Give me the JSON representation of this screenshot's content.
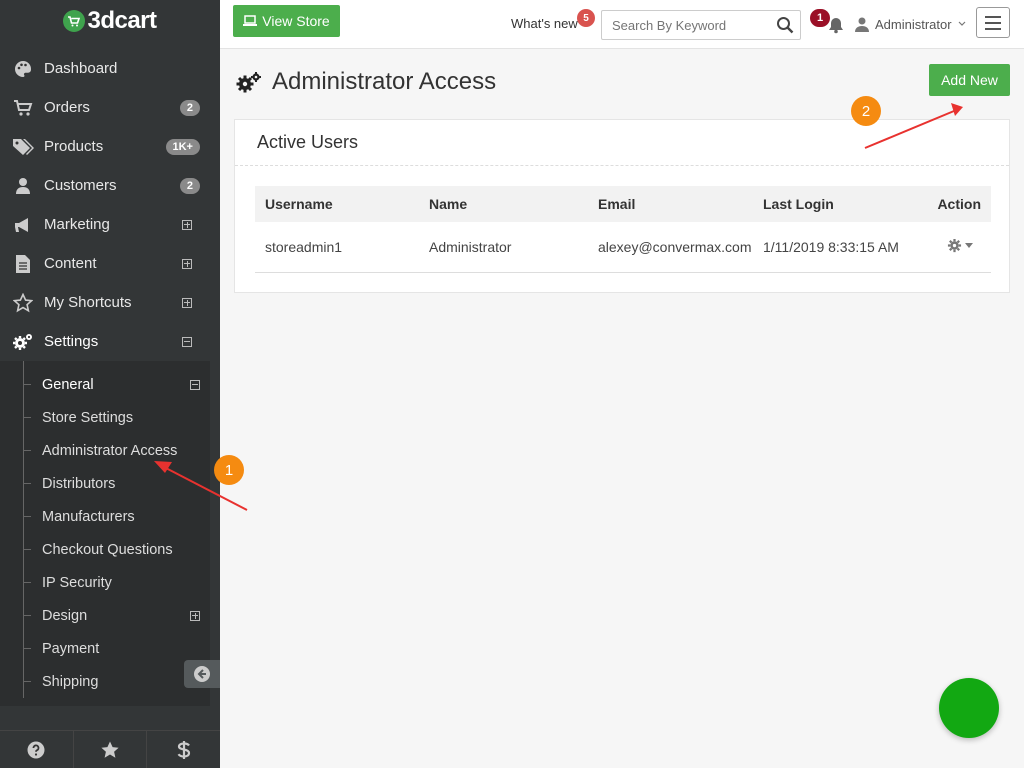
{
  "brand": {
    "logo_text": "3dcart",
    "accent": "#4cae4c"
  },
  "sidebar": {
    "items": [
      {
        "label": "Dashboard",
        "icon": "palette-icon"
      },
      {
        "label": "Orders",
        "icon": "cart-icon",
        "badge": "2"
      },
      {
        "label": "Products",
        "icon": "tags-icon",
        "badge": "1K+"
      },
      {
        "label": "Customers",
        "icon": "user-icon",
        "badge": "2"
      },
      {
        "label": "Marketing",
        "icon": "megaphone-icon",
        "expander": "plus"
      },
      {
        "label": "Content",
        "icon": "file-icon",
        "expander": "plus"
      },
      {
        "label": "My Shortcuts",
        "icon": "star-icon",
        "expander": "plus"
      },
      {
        "label": "Settings",
        "icon": "gears-icon",
        "expander": "minus",
        "active": true
      }
    ],
    "settings_sub": [
      {
        "label": "General",
        "expander": "minus"
      },
      {
        "label": "Store Settings"
      },
      {
        "label": "Administrator Access"
      },
      {
        "label": "Distributors"
      },
      {
        "label": "Manufacturers"
      },
      {
        "label": "Checkout Questions"
      },
      {
        "label": "IP Security"
      },
      {
        "label": "Design",
        "expander": "plus"
      },
      {
        "label": "Payment"
      },
      {
        "label": "Shipping"
      }
    ],
    "bottom_icons": [
      "help-icon",
      "star-icon",
      "dollar-icon"
    ]
  },
  "topbar": {
    "view_store_label": "View Store",
    "whats_new_label": "What's new",
    "whats_new_count": "5",
    "search_placeholder": "Search By Keyword",
    "notifications_count": "1",
    "user_label": "Administrator"
  },
  "page": {
    "title": "Administrator Access",
    "add_new_label": "Add New"
  },
  "panel": {
    "title": "Active Users",
    "columns": [
      "Username",
      "Name",
      "Email",
      "Last Login",
      "Action"
    ],
    "rows": [
      {
        "username": "storeadmin1",
        "name": "Administrator",
        "email": "alexey@convermax.com",
        "last_login": "1/11/2019 8:33:15 AM"
      }
    ]
  },
  "annotations": {
    "callout_1": "1",
    "callout_2": "2",
    "arrow_color": "#e8322f"
  }
}
